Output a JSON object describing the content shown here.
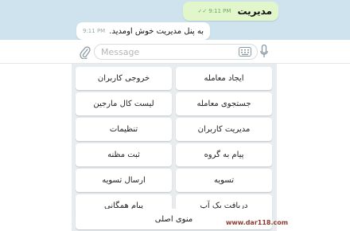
{
  "chat": {
    "outgoing": {
      "text": "مدیریت",
      "time": "9:11 PM"
    },
    "incoming": {
      "text": "به پنل مدیریت خوش اومدید.",
      "time": "9:11 PM"
    }
  },
  "composer": {
    "placeholder": "Message"
  },
  "keyboard": {
    "rows": [
      {
        "right": "ایجاد معامله",
        "left": "خروجی کاربران"
      },
      {
        "right": "جستجوی معامله",
        "left": "لیست کال مارجین"
      },
      {
        "right": "مدیریت کاربران",
        "left": "تنظیمات"
      },
      {
        "right": "پیام به گروه",
        "left": "ثبت مظنه"
      },
      {
        "right": "تسویه",
        "left": "ارسال تسویه"
      },
      {
        "right": "دریافت بک آپ",
        "left": "پیام همگانی"
      }
    ],
    "main_menu": "منوی اصلی"
  },
  "watermark": "www.dar118.com",
  "colors": {
    "chat_bg": "#cfe3ee",
    "outgoing_bubble": "#e1f7cb",
    "keyboard_bg": "#e8ecef"
  }
}
